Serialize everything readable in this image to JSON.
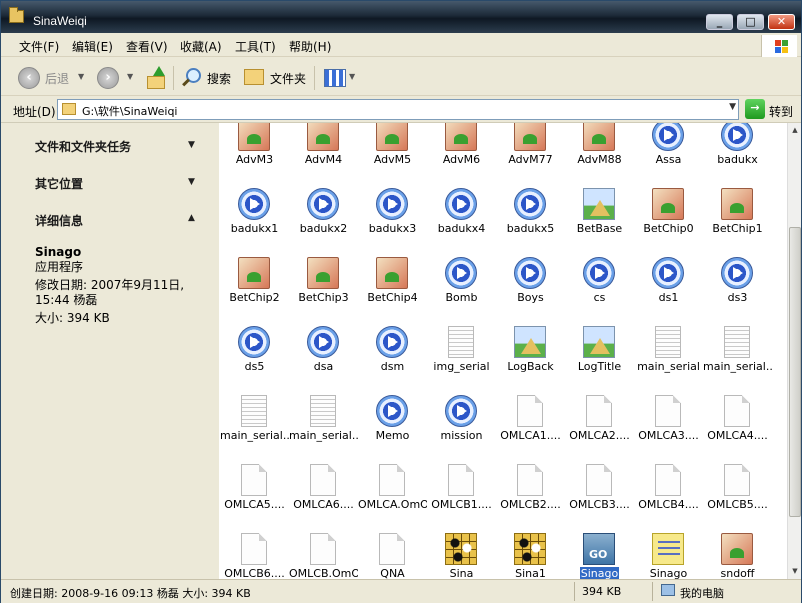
{
  "window": {
    "title": "SinaWeiqi",
    "controls": [
      "_",
      "□",
      "✕"
    ]
  },
  "menu": {
    "items": [
      "文件(F)",
      "编辑(E)",
      "查看(V)",
      "收藏(A)",
      "工具(T)",
      "帮助(H)"
    ]
  },
  "toolbar": {
    "back_label": "后退",
    "search_label": "搜索",
    "folders_label": "文件夹"
  },
  "address": {
    "label": "地址(D)",
    "value": "G:\\软件\\SinaWeiqi",
    "go_label": "转到"
  },
  "tasks": {
    "section1": "文件和文件夹任务",
    "section2": "其它位置",
    "section3": "详细信息",
    "details": {
      "name": "Sinago",
      "type": "应用程序",
      "modified_line1": "修改日期: 2007年9月11日,",
      "modified_line2": "15:44 杨磊",
      "size": "大小: 394 KB"
    }
  },
  "files": [
    {
      "name": "AdvM3",
      "icon": "paint-icon"
    },
    {
      "name": "AdvM4",
      "icon": "paint-icon"
    },
    {
      "name": "AdvM5",
      "icon": "paint-icon"
    },
    {
      "name": "AdvM6",
      "icon": "paint-icon"
    },
    {
      "name": "AdvM77",
      "icon": "paint-icon"
    },
    {
      "name": "AdvM88",
      "icon": "paint-icon"
    },
    {
      "name": "Assa",
      "icon": "media-icon"
    },
    {
      "name": "badukx",
      "icon": "media-icon"
    },
    {
      "name": "badukx1",
      "icon": "media-icon"
    },
    {
      "name": "badukx2",
      "icon": "media-icon"
    },
    {
      "name": "badukx3",
      "icon": "media-icon"
    },
    {
      "name": "badukx4",
      "icon": "media-icon"
    },
    {
      "name": "badukx5",
      "icon": "media-icon"
    },
    {
      "name": "BetBase",
      "icon": "image-icon"
    },
    {
      "name": "BetChip0",
      "icon": "paint-icon"
    },
    {
      "name": "BetChip1",
      "icon": "paint-icon"
    },
    {
      "name": "BetChip2",
      "icon": "paint-icon"
    },
    {
      "name": "BetChip3",
      "icon": "paint-icon"
    },
    {
      "name": "BetChip4",
      "icon": "paint-icon"
    },
    {
      "name": "Bomb",
      "icon": "media-icon"
    },
    {
      "name": "Boys",
      "icon": "media-icon"
    },
    {
      "name": "cs",
      "icon": "media-icon"
    },
    {
      "name": "ds1",
      "icon": "media-icon"
    },
    {
      "name": "ds3",
      "icon": "media-icon"
    },
    {
      "name": "ds5",
      "icon": "media-icon"
    },
    {
      "name": "dsa",
      "icon": "media-icon"
    },
    {
      "name": "dsm",
      "icon": "media-icon"
    },
    {
      "name": "img_serial",
      "icon": "document-lines-icon"
    },
    {
      "name": "LogBack",
      "icon": "image-icon"
    },
    {
      "name": "LogTitle",
      "icon": "image-icon"
    },
    {
      "name": "main_serial",
      "icon": "document-lines-icon"
    },
    {
      "name": "main_serial...",
      "icon": "document-lines-icon"
    },
    {
      "name": "main_serial...",
      "icon": "document-lines-icon"
    },
    {
      "name": "main_serial...",
      "icon": "document-lines-icon"
    },
    {
      "name": "Memo",
      "icon": "media-icon"
    },
    {
      "name": "mission",
      "icon": "media-icon"
    },
    {
      "name": "OMLCA1....",
      "icon": "document-icon"
    },
    {
      "name": "OMLCA2....",
      "icon": "document-icon"
    },
    {
      "name": "OMLCA3....",
      "icon": "document-icon"
    },
    {
      "name": "OMLCA4....",
      "icon": "document-icon"
    },
    {
      "name": "OMLCA5....",
      "icon": "document-icon"
    },
    {
      "name": "OMLCA6....",
      "icon": "document-icon"
    },
    {
      "name": "OMLCA.OmO",
      "icon": "document-icon"
    },
    {
      "name": "OMLCB1....",
      "icon": "document-icon"
    },
    {
      "name": "OMLCB2....",
      "icon": "document-icon"
    },
    {
      "name": "OMLCB3....",
      "icon": "document-icon"
    },
    {
      "name": "OMLCB4....",
      "icon": "document-icon"
    },
    {
      "name": "OMLCB5....",
      "icon": "document-icon"
    },
    {
      "name": "OMLCB6....",
      "icon": "document-icon"
    },
    {
      "name": "OMLCB.OmO",
      "icon": "document-icon"
    },
    {
      "name": "QNA",
      "icon": "document-icon"
    },
    {
      "name": "Sina",
      "icon": "go-board-icon"
    },
    {
      "name": "Sina1",
      "icon": "go-board-icon"
    },
    {
      "name": "Sinago",
      "icon": "sinago-icon",
      "selected": true
    },
    {
      "name": "Sinago",
      "icon": "yellow-image-icon"
    },
    {
      "name": "sndoff",
      "icon": "paint-icon"
    }
  ],
  "status": {
    "info": "创建日期: 2008-9-16 09:13 杨磊 大小: 394 KB",
    "size": "394 KB",
    "location": "我的电脑"
  }
}
